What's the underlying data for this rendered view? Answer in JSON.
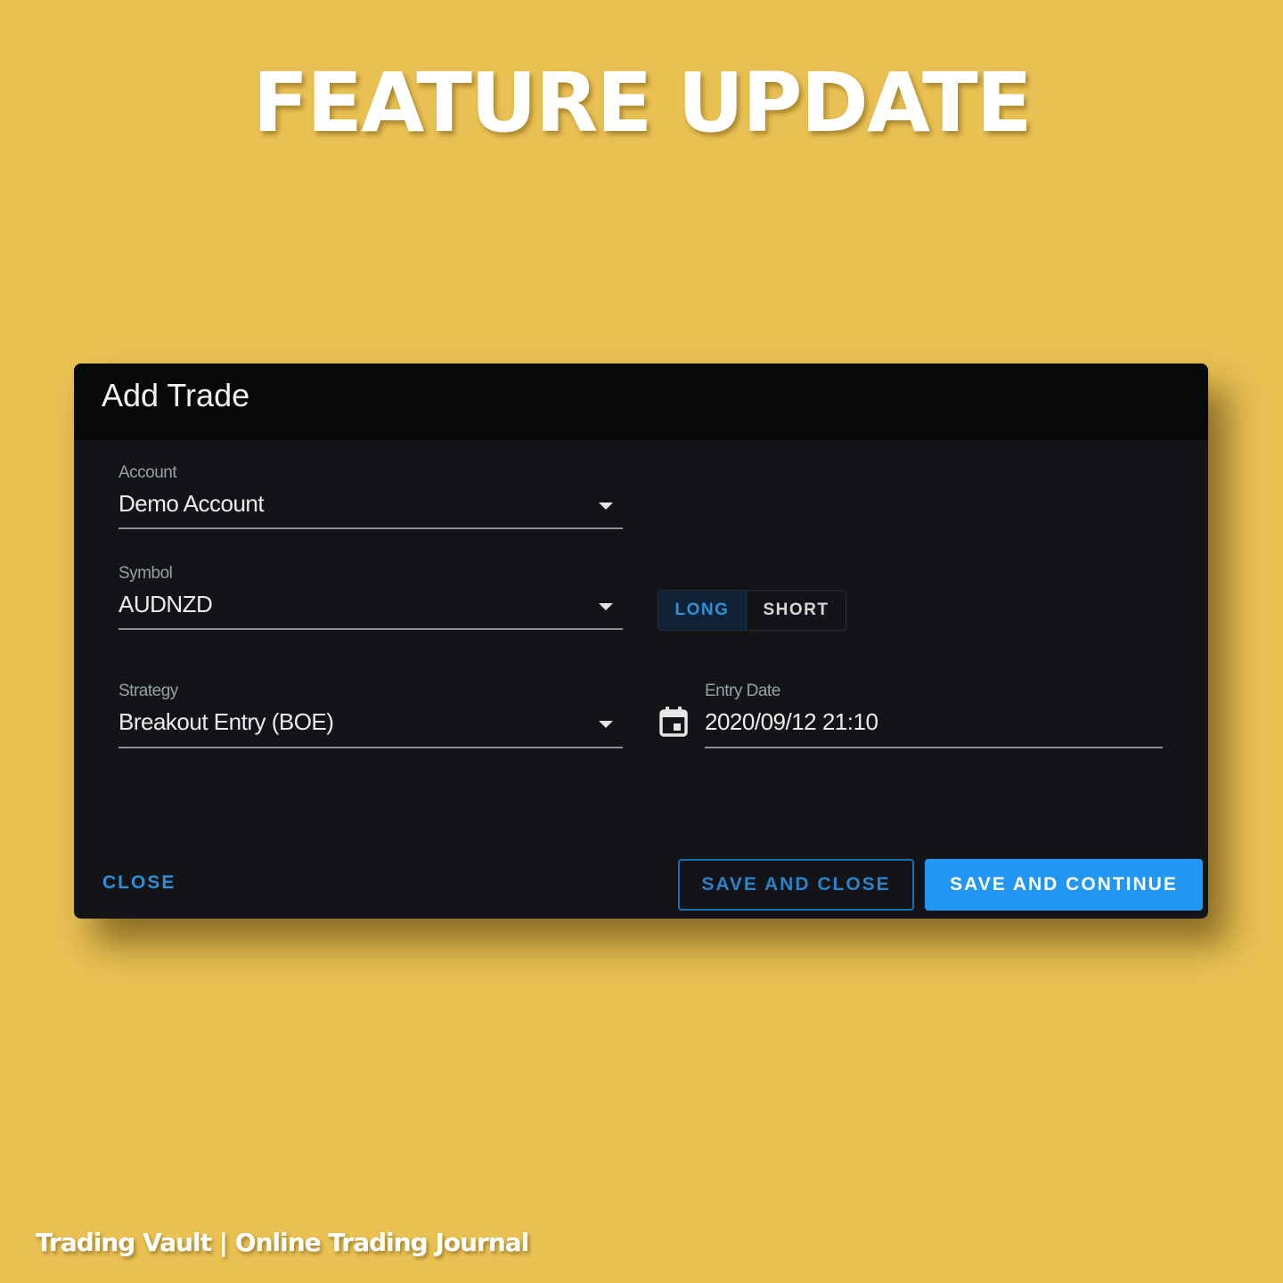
{
  "headline": "FEATURE UPDATE",
  "dialog": {
    "title": "Add Trade",
    "account": {
      "label": "Account",
      "value": "Demo Account"
    },
    "symbol": {
      "label": "Symbol",
      "value": "AUDNZD"
    },
    "direction": {
      "long_label": "LONG",
      "short_label": "SHORT",
      "selected": "LONG"
    },
    "strategy": {
      "label": "Strategy",
      "value": "Breakout Entry (BOE)"
    },
    "entry_date": {
      "label": "Entry Date",
      "value": "2020/09/12 21:10"
    },
    "buttons": {
      "close": "CLOSE",
      "save_and_close": "SAVE AND CLOSE",
      "save_and_continue": "SAVE AND CONTINUE"
    }
  },
  "brand": "Trading Vault | Online Trading Journal",
  "colors": {
    "background": "#E9C153",
    "dialog_bg": "#121418",
    "header_bg": "#08090b",
    "accent": "#2196F3"
  },
  "icons": {
    "dropdown": "caret-down-icon",
    "calendar": "calendar-icon"
  }
}
